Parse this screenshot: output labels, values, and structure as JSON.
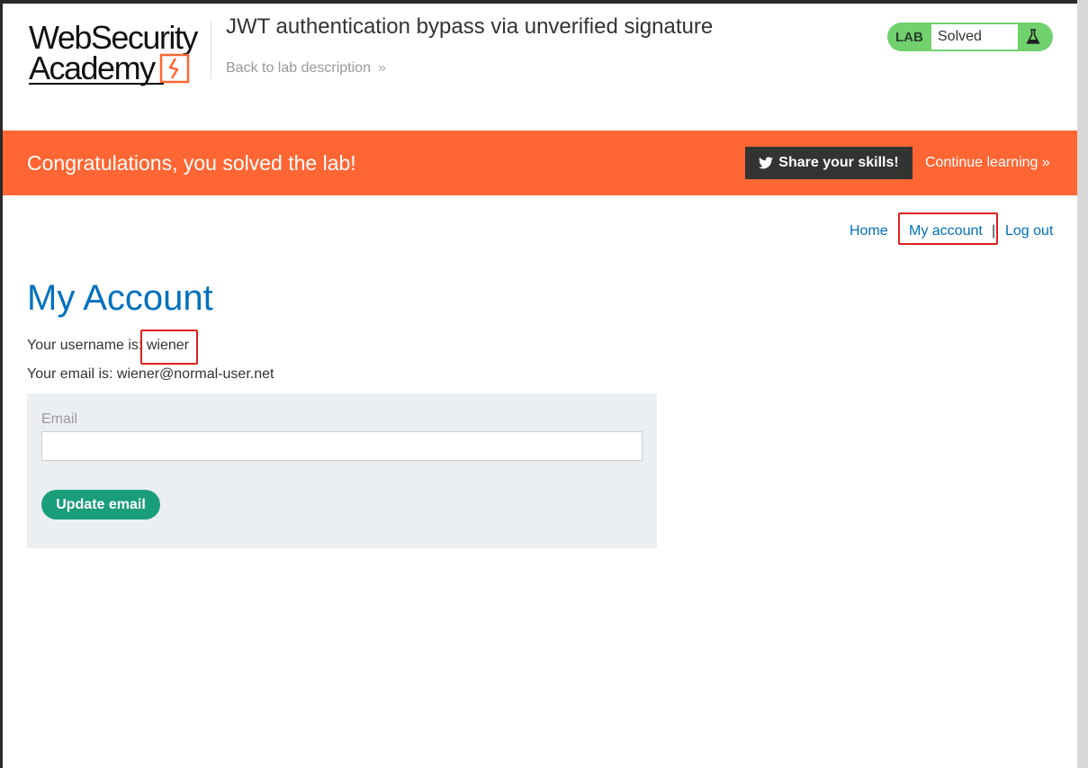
{
  "header": {
    "logo_line1": "WebSecurity",
    "logo_line2": "Academy",
    "lab_title": "JWT authentication bypass via unverified signature",
    "back_link": "Back to lab description",
    "back_chevron": "»",
    "status_label": "LAB",
    "status_value": "Solved",
    "status_icon": "flask-icon",
    "status_color": "#70d16d"
  },
  "banner": {
    "message": "Congratulations, you solved the lab!",
    "share_label": "Share your skills!",
    "share_icon": "twitter-icon",
    "continue_label": "Continue learning",
    "continue_chevron": "»",
    "color": "#ff6633"
  },
  "nav": {
    "home": "Home",
    "my_account": "My account",
    "separator": "|",
    "log_out": "Log out"
  },
  "account": {
    "heading": "My Account",
    "username_label": "Your username is:",
    "username": "wiener",
    "email_label": "Your email is:",
    "email": "wiener@normal-user.net"
  },
  "form": {
    "email_label": "Email",
    "email_value": "",
    "update_button": "Update email"
  },
  "colors": {
    "link": "#0071bc",
    "button": "#1a9d7b",
    "highlight": "#e02020"
  }
}
